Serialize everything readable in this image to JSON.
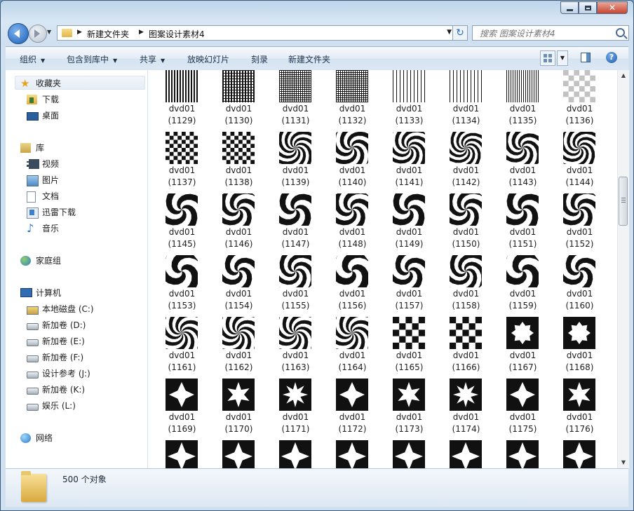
{
  "window": {
    "caption_buttons": [
      "minimize-icon",
      "maximize-icon",
      "close-icon"
    ]
  },
  "address": {
    "crumbs": [
      "新建文件夹",
      "图案设计素材4"
    ]
  },
  "search": {
    "placeholder": "搜索 图案设计素材4"
  },
  "toolbar": {
    "organize": "组织",
    "include_library": "包含到库中",
    "share": "共享",
    "slideshow": "放映幻灯片",
    "burn": "刻录",
    "new_folder": "新建文件夹"
  },
  "nav": {
    "favorites": {
      "label": "收藏夹",
      "items": [
        "下载",
        "桌面"
      ]
    },
    "libraries": {
      "label": "库",
      "items": [
        "视频",
        "图片",
        "文档",
        "迅雷下载",
        "音乐"
      ]
    },
    "homegroup": "家庭组",
    "computer": {
      "label": "计算机",
      "items": [
        "本地磁盘 (C:)",
        "新加卷 (D:)",
        "新加卷 (E:)",
        "新加卷 (F:)",
        "设计参考 (J:)",
        "新加卷 (K:)",
        "娱乐 (L:)"
      ]
    },
    "network": "网络"
  },
  "files": {
    "prefix": "dvd01",
    "rows": [
      [
        "(1129)",
        "(1130)",
        "(1131)",
        "(1132)",
        "(1133)",
        "(1134)",
        "(1135)",
        "(1136)"
      ],
      [
        "(1137)",
        "(1138)",
        "(1139)",
        "(1140)",
        "(1141)",
        "(1142)",
        "(1143)",
        "(1144)"
      ],
      [
        "(1145)",
        "(1146)",
        "(1147)",
        "(1148)",
        "(1149)",
        "(1150)",
        "(1151)",
        "(1152)"
      ],
      [
        "(1153)",
        "(1154)",
        "(1155)",
        "(1156)",
        "(1157)",
        "(1158)",
        "(1159)",
        "(1160)"
      ],
      [
        "(1161)",
        "(1162)",
        "(1163)",
        "(1164)",
        "(1165)",
        "(1166)",
        "(1167)",
        "(1168)"
      ],
      [
        "(1169)",
        "(1170)",
        "(1171)",
        "(1172)",
        "(1173)",
        "(1174)",
        "(1175)",
        "(1176)"
      ]
    ],
    "partial_row_count": 8
  },
  "status": {
    "count": "500 个对象"
  },
  "colors": {
    "accent": "#2a6bbf",
    "pattern": "#111111"
  }
}
